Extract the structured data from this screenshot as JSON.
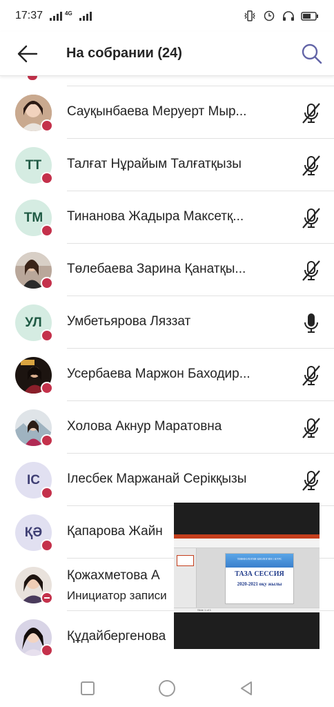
{
  "status_bar": {
    "time": "17:37",
    "network": "4G",
    "icons": [
      "signal-icon",
      "signal-icon",
      "vibrate-icon",
      "alarm-icon",
      "headphones-icon",
      "battery-icon"
    ]
  },
  "app_bar": {
    "title": "На собрании (24)",
    "back_icon": "arrow-left-icon",
    "search_icon": "search-icon"
  },
  "colors": {
    "accent": "#6264a7",
    "presence_busy": "#c4314b",
    "divider": "#e1e1e1"
  },
  "participants": [
    {
      "name": "Сауқынбаева Меруерт Мырзабекқызы",
      "display": "Сауқынбаева Меруерт Мыр...",
      "avatar_type": "photo",
      "mic": "muted",
      "presence": "busy"
    },
    {
      "name": "Талғат Нұрайым Талғатқызы",
      "display": "Талғат Нұрайым Талғатқызы",
      "avatar_type": "initials",
      "initials": "ТТ",
      "avatar_bg": "#d5ece2",
      "avatar_fg": "#1f5a44",
      "mic": "muted",
      "presence": "busy"
    },
    {
      "name": "Тинанова Жадыра Максетқызы",
      "display": "Тинанова Жадыра Максетқ...",
      "avatar_type": "initials",
      "initials": "ТМ",
      "avatar_bg": "#d5ece2",
      "avatar_fg": "#1f5a44",
      "mic": "muted",
      "presence": "busy"
    },
    {
      "name": "Төлебаева Зарина Қанатқызы",
      "display": "Төлебаева Зарина Қанатқы...",
      "avatar_type": "photo",
      "mic": "muted",
      "presence": "busy"
    },
    {
      "name": "Умбетьярова Ляззат",
      "display": "Умбетьярова Ляззат",
      "avatar_type": "initials",
      "initials": "УЛ",
      "avatar_bg": "#d5ece2",
      "avatar_fg": "#1f5a44",
      "mic": "on",
      "presence": "busy"
    },
    {
      "name": "Усербаева Маржон Баходировна",
      "display": "Усербаева Маржон Баходир...",
      "avatar_type": "photo",
      "mic": "muted",
      "presence": "busy"
    },
    {
      "name": "Холова Акнур Маратовна",
      "display": "Холова Акнур Маратовна",
      "avatar_type": "photo",
      "mic": "muted",
      "presence": "busy"
    },
    {
      "name": "Ілесбек Маржанай Серікқызы",
      "display": "Ілесбек Маржанай Серікқызы",
      "avatar_type": "initials",
      "initials": "ІС",
      "avatar_bg": "#e1e0f1",
      "avatar_fg": "#3f3f74",
      "mic": "muted",
      "presence": "busy"
    },
    {
      "name": "Қапарова Жайна",
      "display": "Қапарова Жайн",
      "avatar_type": "initials",
      "initials": "ҚӘ",
      "avatar_bg": "#e1e0f1",
      "avatar_fg": "#3f3f74",
      "mic": "muted",
      "presence": "busy"
    },
    {
      "name": "Қожахметова А",
      "display": "Қожахметова А",
      "subtitle": "Инициатор записи",
      "avatar_type": "photo",
      "mic": "muted",
      "presence": "dnd"
    },
    {
      "name": "Құдайбергенова",
      "display": "Құдайбергенова",
      "avatar_type": "photo",
      "mic": "muted",
      "presence": "busy"
    }
  ],
  "screen_share": {
    "slide_header": "ТИФФОЛОГИЯ БИОЛОГИЯ 1 КУРС",
    "slide_title": "ТАЗА СЕССИЯ",
    "slide_years": "2020-2021 оқу жылы",
    "ppt_status": "Slide 1 of 1"
  },
  "nav_bar": {
    "buttons": [
      "recents-square-icon",
      "home-circle-icon",
      "back-triangle-icon"
    ]
  }
}
